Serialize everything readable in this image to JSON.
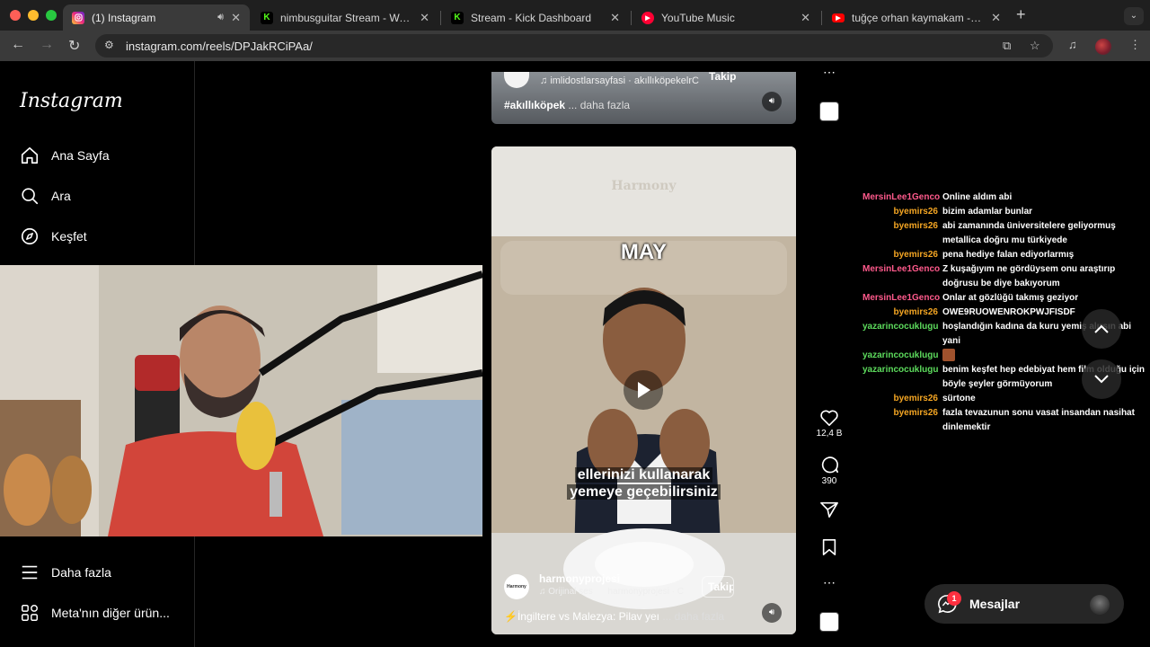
{
  "browser": {
    "tabs": [
      {
        "title": "(1) Instagram",
        "active": true,
        "favicon": "instagram-icon",
        "color": "#e1306c"
      },
      {
        "title": "nimbusguitar Stream - Watch",
        "active": false,
        "favicon": "kick-icon",
        "color": "#53fc18"
      },
      {
        "title": "Stream - Kick Dashboard",
        "active": false,
        "favicon": "kick-icon",
        "color": "#53fc18"
      },
      {
        "title": "YouTube Music",
        "active": false,
        "favicon": "youtube-music-icon",
        "color": "#ff0033"
      },
      {
        "title": "tuğçe orhan kaymakam - You",
        "active": false,
        "favicon": "youtube-icon",
        "color": "#ff0000"
      }
    ],
    "url": "instagram.com/reels/DPJakRCiPAa/"
  },
  "sidebar": {
    "logo": "Instagram",
    "items_top": [
      {
        "label": "Ana Sayfa",
        "icon": "home-icon"
      },
      {
        "label": "Ara",
        "icon": "search-icon"
      },
      {
        "label": "Keşfet",
        "icon": "explore-icon"
      }
    ],
    "items_bottom": [
      {
        "label": "Daha fazla",
        "icon": "menu-icon"
      },
      {
        "label": "Meta'nın diğer ürün...",
        "icon": "meta-apps-icon"
      }
    ]
  },
  "reel_top": {
    "follow": "Takip",
    "audio": "imlidostlarsayfasi · akıllıköpekelrC",
    "caption_tag": "#akıllıköpek",
    "more": " ... daha fazla"
  },
  "reel_main": {
    "overlay_top": "MAY",
    "wall_brand": "Harmony",
    "subtitle_line1": "ellerinizi kullanarak",
    "subtitle_line2": "yemeye geçebilirsiniz",
    "username": "harmonyprojesi",
    "avatar_text": "Harmony",
    "audio": "Orijinal ses",
    "audio_user": "harmonyprojesi · C",
    "follow": "Takip",
    "caption": "⚡İngiltere vs Malezya: Pilav yeı",
    "more": " ... daha fazla"
  },
  "actions": {
    "likes": "12,4 B",
    "comments": "390"
  },
  "chat": [
    {
      "user": "MersinLee1Genco",
      "color": "#ff5a8c",
      "text": "Online aldım abi"
    },
    {
      "user": "byemirs26",
      "color": "#f5a623",
      "text": "bizim adamlar bunlar"
    },
    {
      "user": "byemirs26",
      "color": "#f5a623",
      "text": "abi zamanında üniversitelere geliyormuş metallica doğru mu türkiyede"
    },
    {
      "user": "byemirs26",
      "color": "#f5a623",
      "text": "pena hediye falan ediyorlarmış"
    },
    {
      "user": "MersinLee1Genco",
      "color": "#ff5a8c",
      "text": "Z kuşağıyım ne gördüysem onu araştırıp doğrusu be diye bakıyorum"
    },
    {
      "user": "MersinLee1Genco",
      "color": "#ff5a8c",
      "text": "Onlar at gözlüğü takmış geziyor"
    },
    {
      "user": "byemirs26",
      "color": "#f5a623",
      "text": "OWE9RUOWENROKPWJFISDF"
    },
    {
      "user": "yazarincocuklugu",
      "color": "#5ddc5d",
      "text": "hoşlandığın kadına da kuru yemiş alırsın abi yani"
    },
    {
      "user": "yazarincocuklugu",
      "color": "#5ddc5d",
      "text": "",
      "emote": true
    },
    {
      "user": "yazarincocuklugu",
      "color": "#5ddc5d",
      "text": "benim keşfet hep edebiyat hem film olduğu için böyle şeyler görmüyorum"
    },
    {
      "user": "byemirs26",
      "color": "#f5a623",
      "text": "sürtone"
    },
    {
      "user": "byemirs26",
      "color": "#f5a623",
      "text": "fazla tevazunun sonu vasat insandan nasihat dinlemektir"
    }
  ],
  "messages": {
    "label": "Mesajlar",
    "badge": "1"
  }
}
